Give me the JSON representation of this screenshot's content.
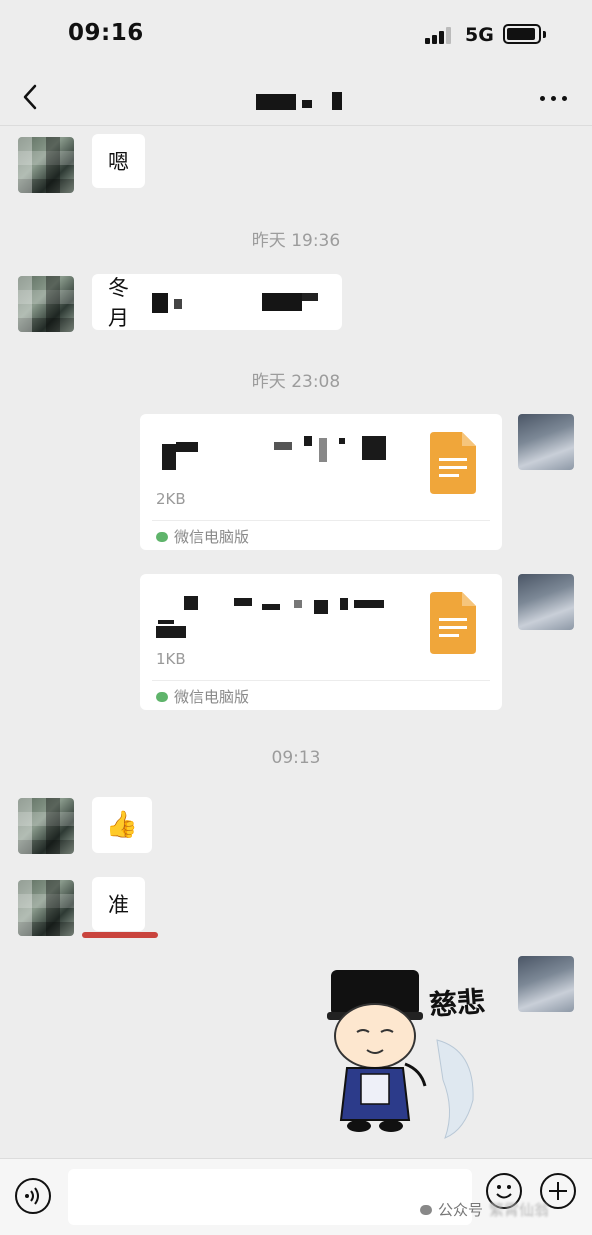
{
  "status_bar": {
    "time": "09:16",
    "network": "5G"
  },
  "nav": {
    "title_redacted": true
  },
  "messages": [
    {
      "side": "left",
      "type": "text",
      "text": "嗯"
    },
    {
      "type": "timestamp",
      "text": "昨天 19:36"
    },
    {
      "side": "left",
      "type": "text",
      "text": "冬月",
      "redacted_rest": true
    },
    {
      "type": "timestamp",
      "text": "昨天 23:08"
    },
    {
      "side": "right",
      "type": "file",
      "size": "2KB",
      "source": "微信电脑版",
      "icon": "document-icon"
    },
    {
      "side": "right",
      "type": "file",
      "size": "1KB",
      "source": "微信电脑版",
      "icon": "document-icon"
    },
    {
      "type": "timestamp",
      "text": "09:13"
    },
    {
      "side": "left",
      "type": "emoji",
      "emoji": "👍",
      "icon": "thumbs-up-icon"
    },
    {
      "side": "left",
      "type": "text",
      "text": "准",
      "underlined": true
    },
    {
      "side": "right",
      "type": "sticker",
      "caption": "慈悲"
    }
  ],
  "input_bar": {
    "voice_icon": "voice-icon",
    "emoji_icon": "smiley-icon",
    "plus_icon": "plus-icon",
    "input_value": ""
  },
  "watermark": {
    "label": "公众号",
    "name_blurred": "繁霄仙翁"
  },
  "colors": {
    "background": "#ededed",
    "bubble": "#ffffff",
    "file_icon": "#f0a63a",
    "underline": "#c9443d"
  }
}
